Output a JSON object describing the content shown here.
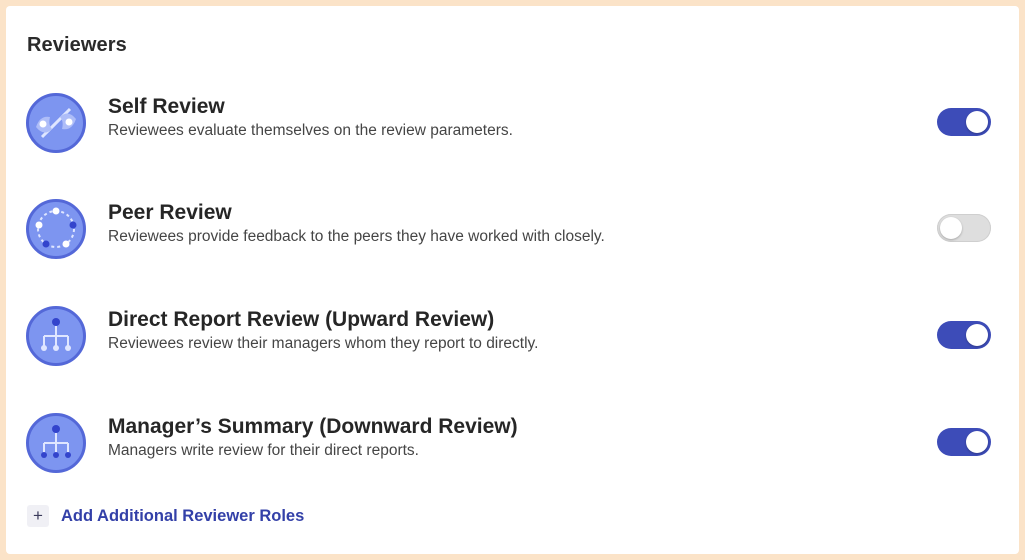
{
  "section": {
    "title": "Reviewers"
  },
  "reviewers": [
    {
      "title": "Self Review",
      "description": "Reviewees evaluate themselves on the review parameters.",
      "enabled": true,
      "icon": "self-review-icon"
    },
    {
      "title": "Peer Review",
      "description": "Reviewees provide feedback to the peers they have worked with closely.",
      "enabled": false,
      "icon": "peer-review-icon"
    },
    {
      "title": "Direct Report Review (Upward Review)",
      "description": "Reviewees review their managers whom they report to directly.",
      "enabled": true,
      "icon": "upward-review-icon"
    },
    {
      "title": "Manager’s Summary (Downward Review)",
      "description": "Managers write review for their direct reports.",
      "enabled": true,
      "icon": "downward-review-icon"
    }
  ],
  "add_roles": {
    "icon": "plus-icon",
    "glyph": "+",
    "label": "Add Additional Reviewer Roles"
  },
  "colors": {
    "accent": "#3d4cb8",
    "toggle_off": "#dedede",
    "icon_bg": "#7d95f0",
    "icon_ring": "#5468d8",
    "link": "#3340a8"
  }
}
